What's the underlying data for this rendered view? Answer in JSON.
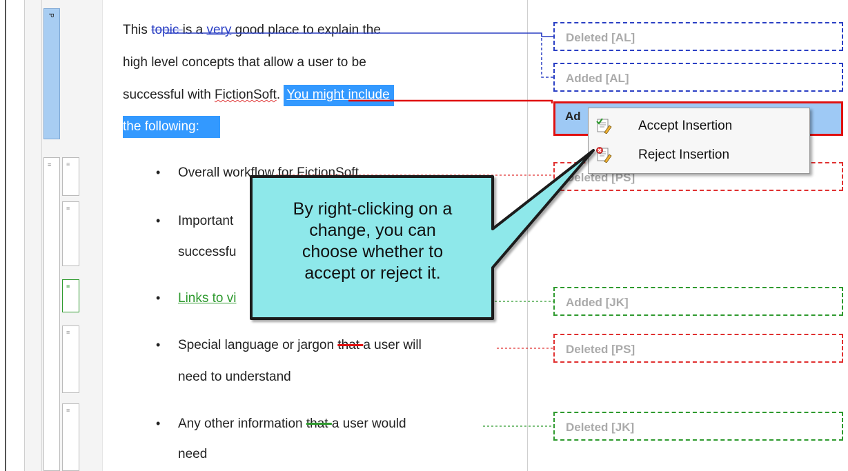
{
  "gutter": {
    "tag_p_label": "P",
    "list_glyph": "≡"
  },
  "document": {
    "para_line1": {
      "before": "This ",
      "deleted": "topic ",
      "middle": "is a ",
      "inserted": "very",
      "after": " good place to explain the"
    },
    "para_line2": "high level concepts that allow a user to be",
    "para_line3": {
      "before": "successful with ",
      "misspelled": "FictionSoft",
      "after": ". ",
      "selected": "You might include"
    },
    "para_line4": {
      "selected": "the following:"
    },
    "bullet_char": "•",
    "bullets": [
      {
        "text": "Overall workflow for FictionSoft"
      },
      {
        "text_line1": "Important",
        "text_line2": "successfu"
      },
      {
        "text": "Links to vi"
      },
      {
        "before": "Special language or jargon ",
        "deleted": "that ",
        "after": "a user will",
        "line2": "need to understand"
      },
      {
        "before": "Any other information ",
        "deleted": "that ",
        "after": "a user would",
        "line2": "need"
      }
    ]
  },
  "changes": [
    {
      "label": "Deleted [AL]",
      "color": "#2a3fc4"
    },
    {
      "label": "Added [AL]",
      "color": "#2a3fc4"
    },
    {
      "label": "Ad",
      "color": "#e01010",
      "state": "selected"
    },
    {
      "label": "Deleted [PS]",
      "color": "#e03030"
    },
    {
      "label": "Added [JK]",
      "color": "#2e9a2e"
    },
    {
      "label": "Deleted [PS]",
      "color": "#e03030"
    },
    {
      "label": "Deleted [JK]",
      "color": "#2e9a2e"
    }
  ],
  "context_menu": {
    "items": [
      {
        "label": "Accept Insertion",
        "icon": "accept-insertion-icon"
      },
      {
        "label": "Reject Insertion",
        "icon": "reject-insertion-icon"
      }
    ]
  },
  "callout": {
    "lines": [
      "By right-clicking on a",
      "change, you can",
      "choose whether to",
      "accept or reject it."
    ],
    "fill": "#8ee8ea"
  }
}
